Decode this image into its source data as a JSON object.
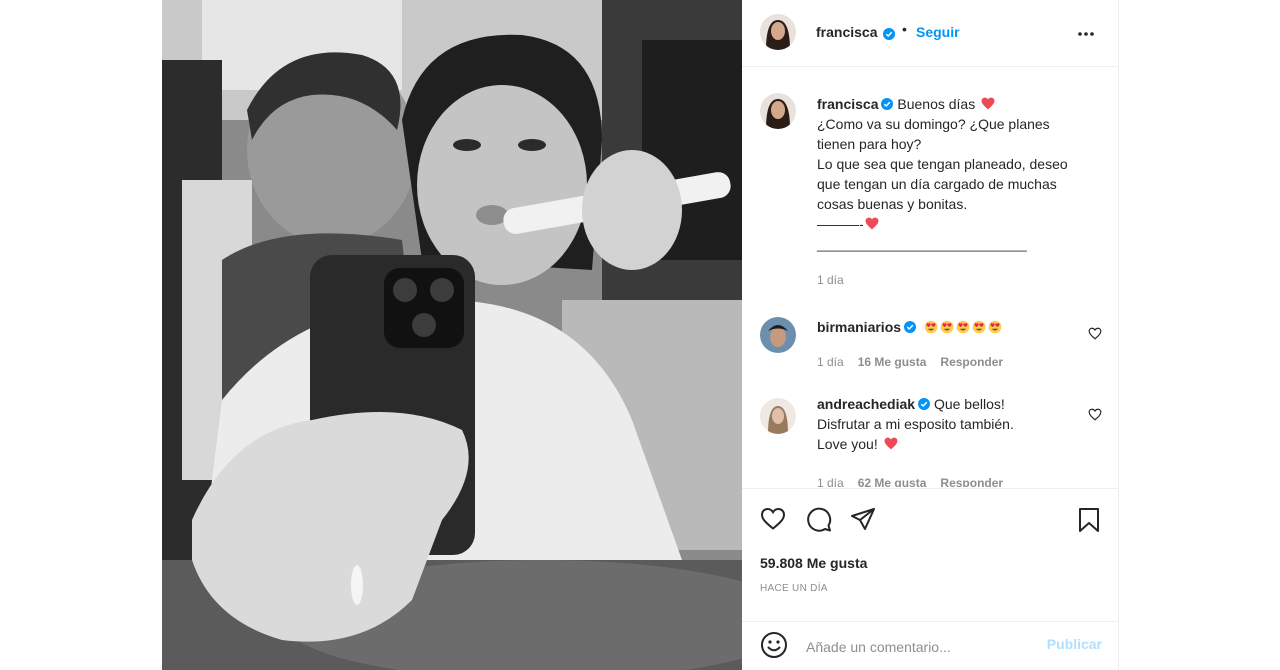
{
  "post": {
    "author": "francisca",
    "follow_label": "Seguir",
    "caption": {
      "greeting": "Buenos días",
      "lines": [
        "¿Como va su domingo? ¿Que planes",
        "tienen para hoy?",
        "Lo que sea que tengan planeado, deseo",
        "que tengan un día cargado de muchas",
        "cosas buenas y bonitas."
      ],
      "dash_line": "———-",
      "underline": "_____________________________",
      "time": "1 día"
    },
    "comments": [
      {
        "user": "birmaniarios",
        "emoji_count": 5,
        "time": "1 día",
        "likes": "16 Me gusta",
        "reply": "Responder"
      },
      {
        "user": "andreachediak",
        "lines": [
          "Que bellos!",
          "Disfrutar a mi esposito también.",
          "Love you!"
        ],
        "time": "1 día",
        "likes": "62 Me gusta",
        "reply": "Responder"
      }
    ],
    "likes_count": "59.808 Me gusta",
    "posted_when": "HACE UN DÍA",
    "add_comment_placeholder": "Añade un comentario...",
    "publish_label": "Publicar"
  },
  "colors": {
    "link_blue": "#0095f6",
    "publish_disabled": "#b2dffc",
    "heart_red": "#ed4956",
    "muted_gray": "#8e8e8e"
  },
  "icons": [
    "verified-badge-icon",
    "more-options-icon",
    "red-heart-icon",
    "heart-eyes-emoji-icon",
    "like-heart-icon",
    "comment-icon",
    "share-icon",
    "save-bookmark-icon",
    "emoji-smiley-icon"
  ]
}
